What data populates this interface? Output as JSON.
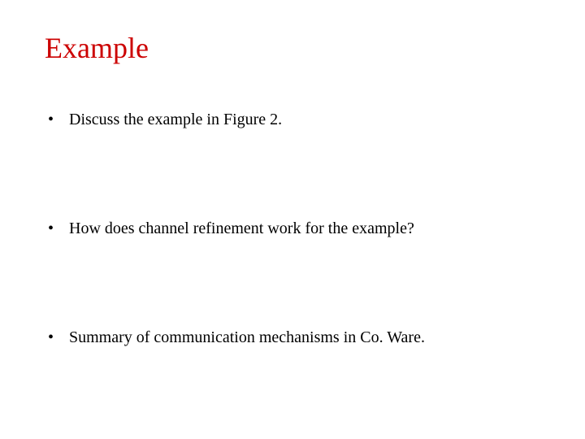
{
  "title": "Example",
  "bullets": [
    "Discuss the example in Figure 2.",
    "How does channel refinement work for the example?",
    "Summary of communication mechanisms in Co. Ware."
  ]
}
